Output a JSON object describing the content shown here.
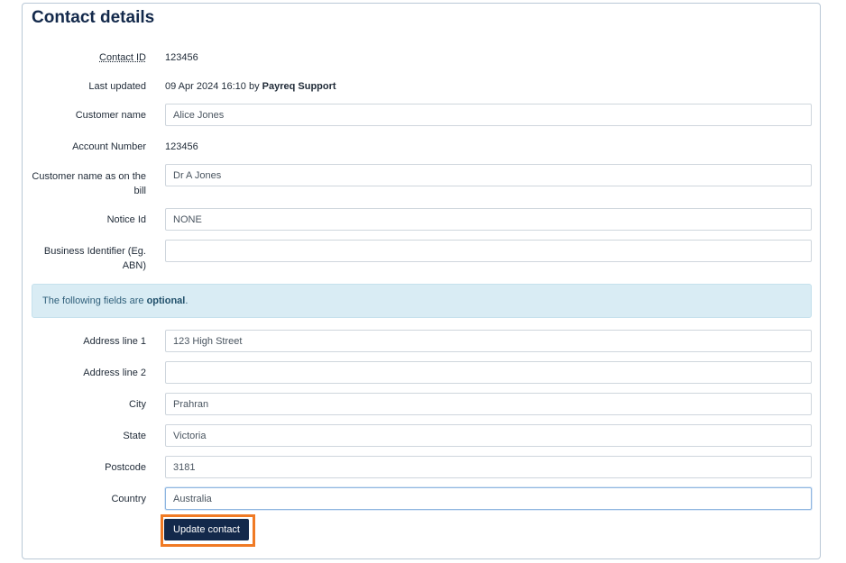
{
  "title": "Contact details",
  "contact_id": {
    "label": "Contact ID",
    "value": "123456"
  },
  "last_updated": {
    "label": "Last updated",
    "value": "09 Apr 2024 16:10 by ",
    "by": "Payreq Support"
  },
  "customer_name": {
    "label": "Customer name",
    "value": "Alice Jones"
  },
  "account_number": {
    "label": "Account Number",
    "value": "123456"
  },
  "bill_name": {
    "label_line1": "Customer name as on the",
    "label_line2": "bill",
    "value": "Dr A Jones"
  },
  "notice_id": {
    "label": "Notice Id",
    "value": "NONE"
  },
  "business_identifier": {
    "label_line1": "Business Identifier (Eg.",
    "label_line2": "ABN)",
    "value": ""
  },
  "info": {
    "prefix": "The following fields are ",
    "emphasis": "optional",
    "suffix": "."
  },
  "address_line1": {
    "label": "Address line 1",
    "value": "123 High Street"
  },
  "address_line2": {
    "label": "Address line 2",
    "value": ""
  },
  "city": {
    "label": "City",
    "value": "Prahran"
  },
  "state": {
    "label": "State",
    "value": "Victoria"
  },
  "postcode": {
    "label": "Postcode",
    "value": "3181"
  },
  "country": {
    "label": "Country",
    "value": "Australia"
  },
  "submit": {
    "label": "Update contact"
  },
  "colors": {
    "primary": "#13294b",
    "highlight": "#f07a24",
    "info_bg": "#d9ecf4"
  }
}
